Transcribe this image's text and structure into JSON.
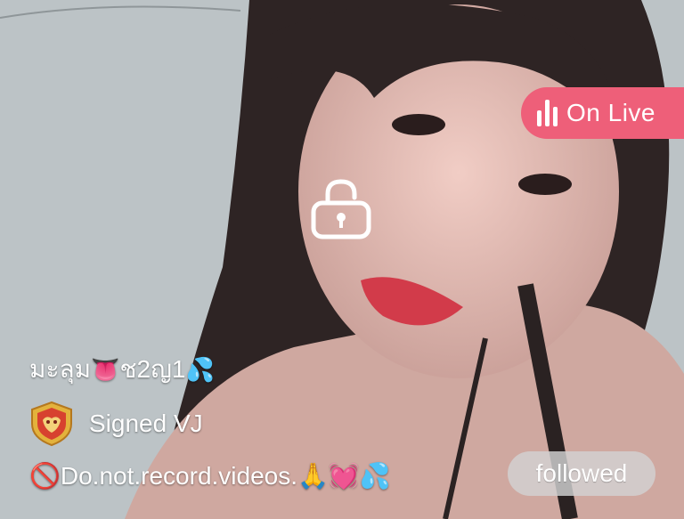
{
  "live_badge": {
    "label": "On Live",
    "color": "#ee5f79",
    "icon": "audio-bars-icon"
  },
  "lock_icon": "lock-icon",
  "streamer": {
    "name": "มะลุม",
    "name_emoji": "👅",
    "name_suffix": "ช2ญ1",
    "name_suffix_emoji": "💦",
    "badge_icon": "vj-shield-icon",
    "badge_label": "Signed VJ"
  },
  "notice": {
    "prefix_icon": "🚫",
    "text": "Do.not.record.videos.",
    "emojis": "🙏💓💦"
  },
  "follow_button": {
    "label": "followed"
  }
}
